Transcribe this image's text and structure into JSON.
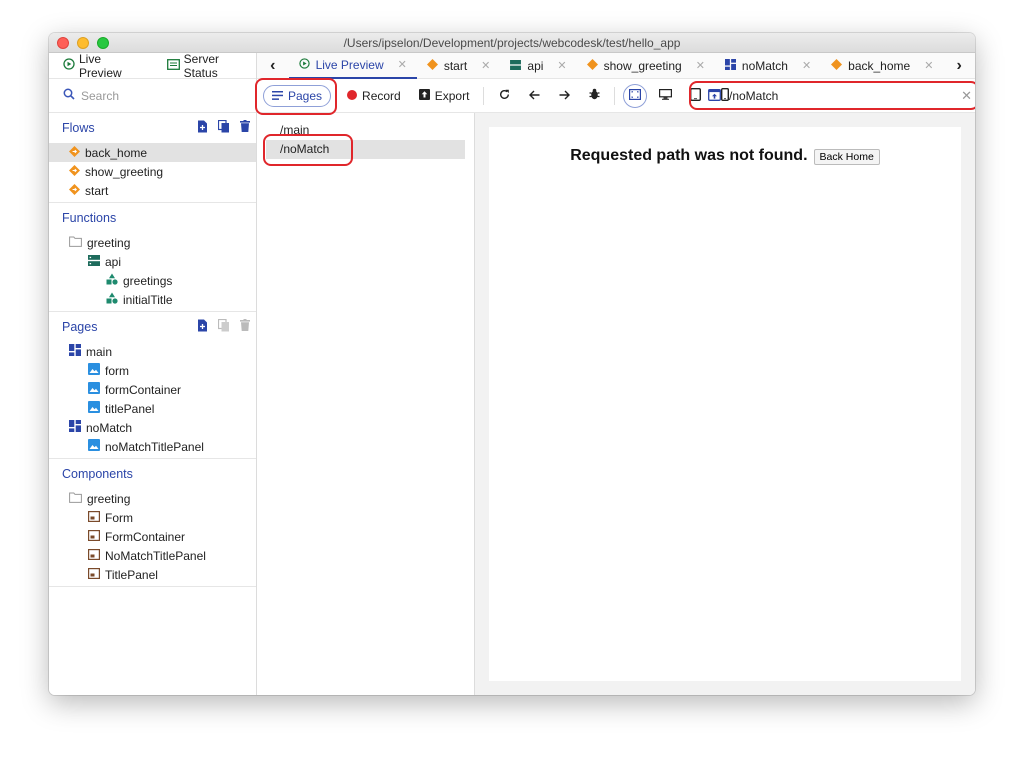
{
  "window": {
    "title": "/Users/ipselon/Development/projects/webcodesk/test/hello_app"
  },
  "left_top": {
    "live_preview": "Live Preview",
    "server_status": "Server Status"
  },
  "search": {
    "placeholder": "Search"
  },
  "flows": {
    "title": "Flows",
    "items": [
      {
        "label": "back_home"
      },
      {
        "label": "show_greeting"
      },
      {
        "label": "start"
      }
    ]
  },
  "functions": {
    "title": "Functions",
    "folder": "greeting",
    "api": "api",
    "items": [
      {
        "label": "greetings"
      },
      {
        "label": "initialTitle"
      }
    ]
  },
  "pages": {
    "title": "Pages",
    "main": "main",
    "main_items": [
      {
        "label": "form"
      },
      {
        "label": "formContainer"
      },
      {
        "label": "titlePanel"
      }
    ],
    "nomatch": "noMatch",
    "nomatch_items": [
      {
        "label": "noMatchTitlePanel"
      }
    ]
  },
  "components": {
    "title": "Components",
    "folder": "greeting",
    "items": [
      {
        "label": "Form"
      },
      {
        "label": "FormContainer"
      },
      {
        "label": "NoMatchTitlePanel"
      },
      {
        "label": "TitlePanel"
      }
    ]
  },
  "tabs": [
    {
      "label": "Live Preview",
      "icon": "live-preview-icon"
    },
    {
      "label": "start",
      "icon": "flow-icon"
    },
    {
      "label": "api",
      "icon": "api-icon"
    },
    {
      "label": "show_greeting",
      "icon": "flow-icon"
    },
    {
      "label": "noMatch",
      "icon": "page-icon"
    },
    {
      "label": "back_home",
      "icon": "flow-icon"
    }
  ],
  "toolbar": {
    "pages": "Pages",
    "record": "Record",
    "export": "Export",
    "url": "/noMatch"
  },
  "page_list": [
    "/main",
    "/noMatch"
  ],
  "preview": {
    "heading": "Requested path was not found.",
    "button": "Back Home"
  },
  "colors": {
    "accent": "#2b45a8",
    "flow": "#f0931e",
    "highlight": "#e0262b",
    "record": "#e0262b"
  }
}
